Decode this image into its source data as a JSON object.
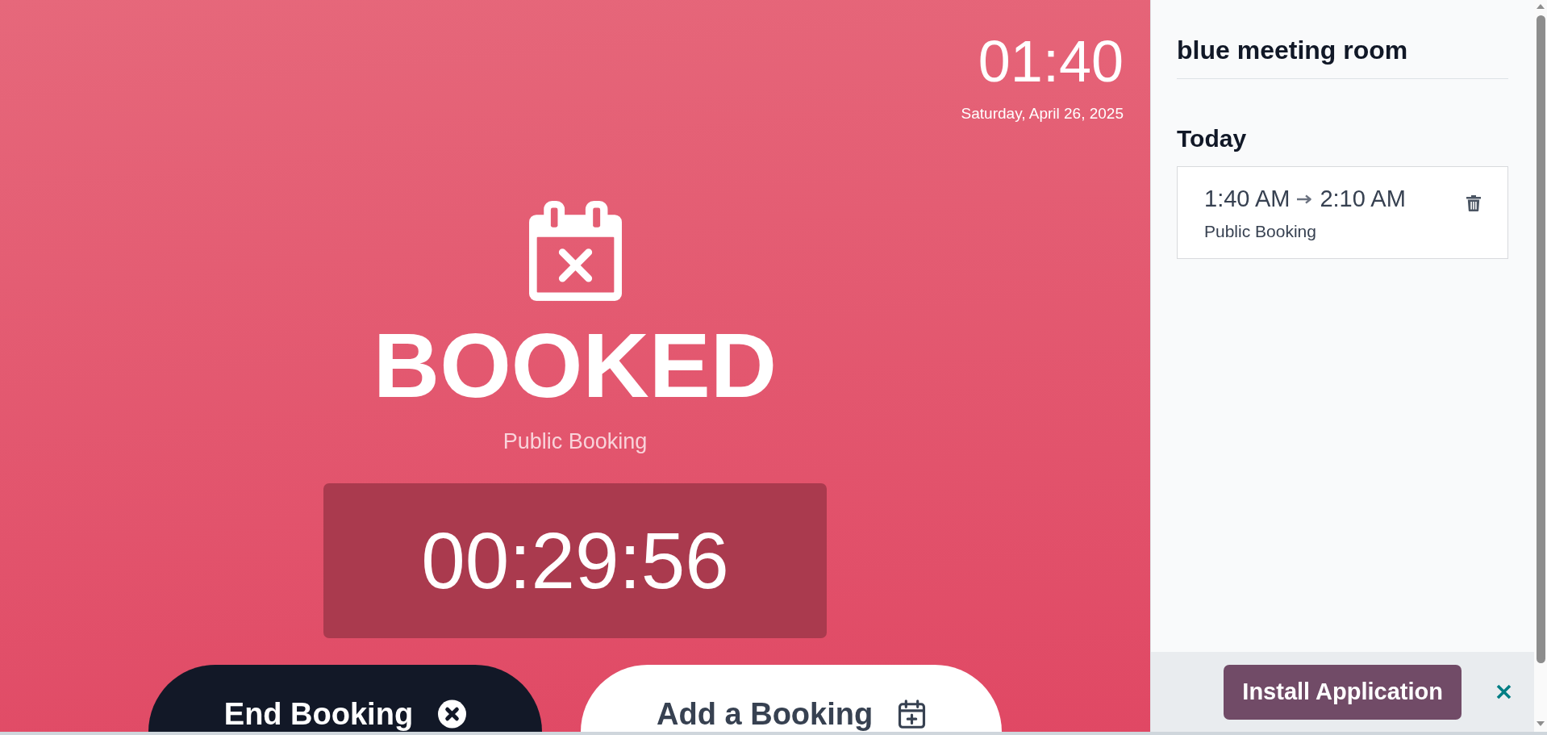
{
  "clock": {
    "time": "01:40",
    "date": "Saturday, April 26, 2025"
  },
  "status": {
    "label": "BOOKED",
    "booking_name": "Public Booking",
    "countdown": "00:29:56"
  },
  "actions": [
    {
      "label": "End Booking",
      "kind": "end"
    },
    {
      "label": "Add a Booking",
      "kind": "add"
    }
  ],
  "sidebar": {
    "room_name": "blue meeting room",
    "day_heading": "Today",
    "bookings": [
      {
        "start": "1:40 AM",
        "end": "2:10 AM",
        "name": "Public Booking"
      }
    ]
  },
  "install_banner": {
    "button": "Install Application"
  }
}
